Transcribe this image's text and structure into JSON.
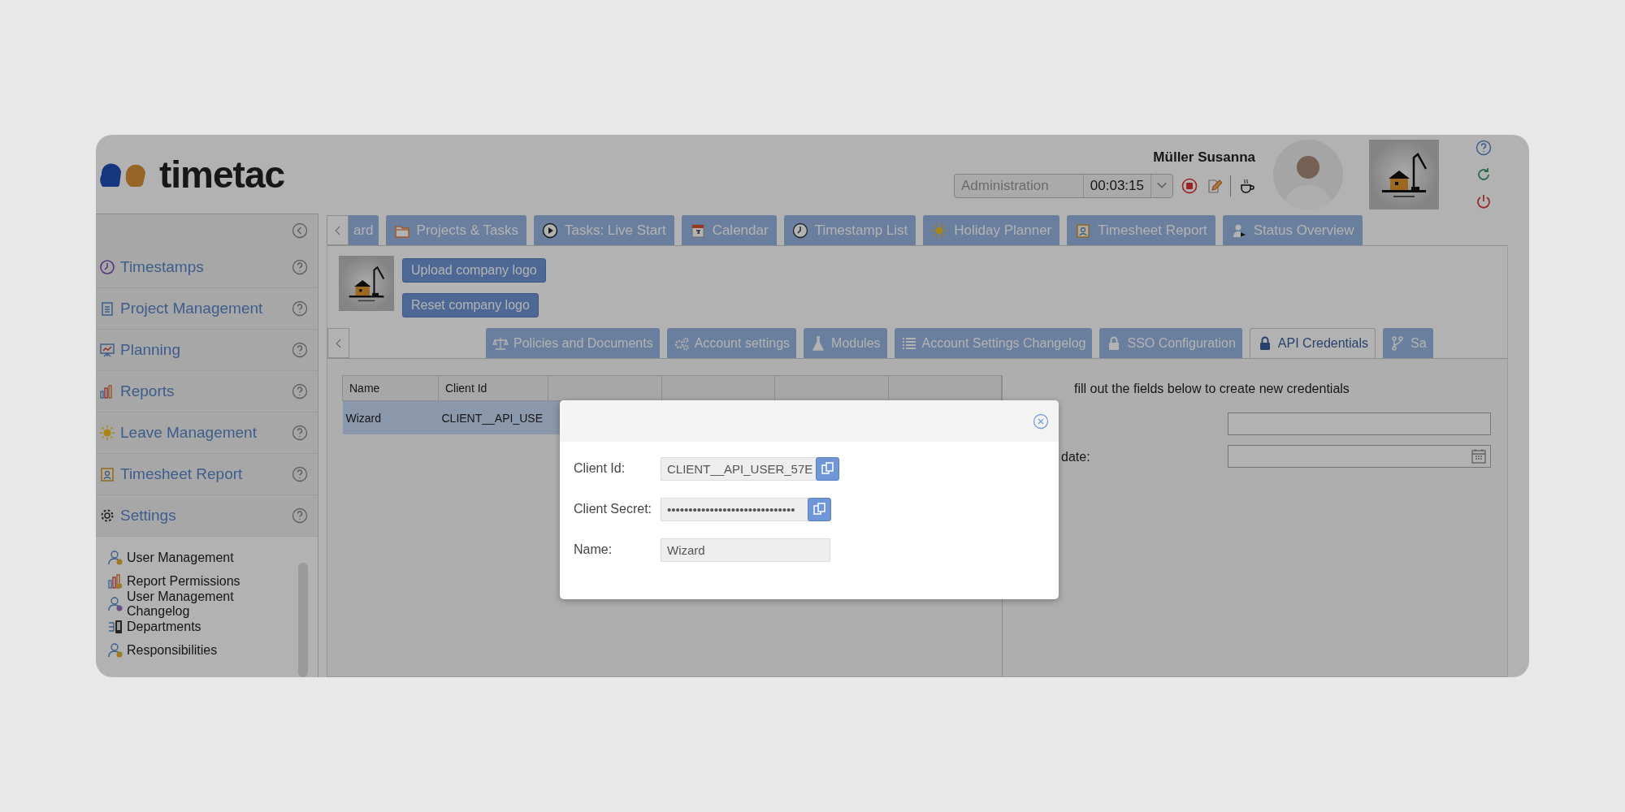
{
  "brand": {
    "name": "timetac"
  },
  "user": {
    "name": "Müller Susanna"
  },
  "timer": {
    "project": "Administration",
    "elapsed": "00:03:15"
  },
  "sidebar": {
    "items": [
      {
        "label": "Timestamps"
      },
      {
        "label": "Project Management"
      },
      {
        "label": "Planning"
      },
      {
        "label": "Reports"
      },
      {
        "label": "Leave Management"
      },
      {
        "label": "Timesheet Report"
      },
      {
        "label": "Settings"
      }
    ],
    "settings_items": [
      "User Management",
      "Report Permissions",
      "User Management Changelog",
      "Departments",
      "Responsibilities"
    ]
  },
  "tabs": [
    {
      "label": "ard",
      "selected": false
    },
    {
      "label": "Projects & Tasks",
      "selected": false
    },
    {
      "label": "Tasks: Live Start",
      "selected": false
    },
    {
      "label": "Calendar",
      "selected": false
    },
    {
      "label": "Timestamp List",
      "selected": false
    },
    {
      "label": "Holiday Planner",
      "selected": false
    },
    {
      "label": "Timesheet Report",
      "selected": false
    },
    {
      "label": "Status Overview",
      "selected": false
    }
  ],
  "company_logo": {
    "buttons": [
      "Upload company logo",
      "Reset company logo"
    ]
  },
  "sub_tabs": [
    {
      "label": "Policies and Documents",
      "selected": false
    },
    {
      "label": "Account settings",
      "selected": false
    },
    {
      "label": "Modules",
      "selected": false
    },
    {
      "label": "Account Settings Changelog",
      "selected": false
    },
    {
      "label": "SSO Configuration",
      "selected": false
    },
    {
      "label": "API Credentials",
      "selected": true
    },
    {
      "label": "Sa",
      "selected": false
    }
  ],
  "credentials_table": {
    "columns": [
      "Name",
      "Client Id"
    ],
    "rows": [
      {
        "cells": [
          "Wizard",
          "CLIENT__API_USE"
        ],
        "selected": true
      }
    ]
  },
  "create_form": {
    "intro": "fill out the fields below to create new credentials",
    "date_label": "date:"
  },
  "dialog": {
    "fields": [
      {
        "label": "Client Id:",
        "value": "CLIENT__API_USER_57E",
        "copyable": true
      },
      {
        "label": "Client Secret:",
        "value": "••••••••••••••••••••••••••••••",
        "copyable": true
      },
      {
        "label": "Name:",
        "value": "Wizard",
        "copyable": false
      }
    ]
  }
}
